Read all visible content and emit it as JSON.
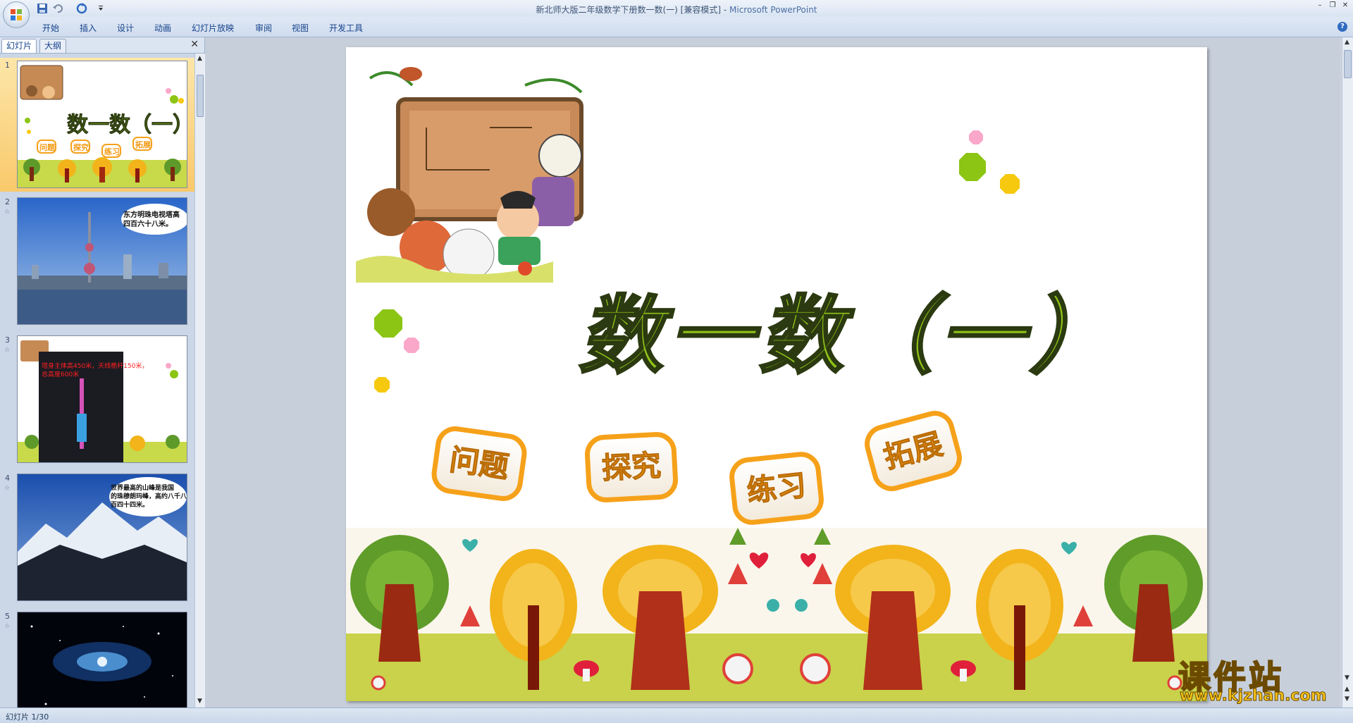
{
  "window": {
    "title_doc": "新北师大版二年级数学下册数一数(一) [兼容模式]",
    "title_sep": " - ",
    "title_app": "Microsoft PowerPoint"
  },
  "ribbon": {
    "tabs": [
      "开始",
      "插入",
      "设计",
      "动画",
      "幻灯片放映",
      "审阅",
      "视图",
      "开发工具"
    ]
  },
  "left_pane": {
    "tabs": [
      "幻灯片",
      "大纲"
    ],
    "thumbnails": [
      {
        "number": "1",
        "selected": true,
        "texts": [
          "数一数（一）",
          "问题",
          "探究",
          "练习",
          "拓展"
        ]
      },
      {
        "number": "2",
        "texts": [
          "东方明珠电视塔高",
          "四百六十八米。"
        ]
      },
      {
        "number": "3",
        "texts": [
          "塔身主体高450米，天线桅杆150米，",
          "总高度600米"
        ]
      },
      {
        "number": "4",
        "texts": [
          "世界最高的山峰是我国",
          "的珠穆朗玛峰，高约八千八",
          "百四十四米。"
        ]
      },
      {
        "number": "5",
        "texts": []
      }
    ]
  },
  "slide": {
    "title": "数一数（一）",
    "buttons": [
      "问题",
      "探究",
      "练习",
      "拓展"
    ],
    "watermark_top": "课件站",
    "watermark_url": "www.kjzhan.com"
  },
  "status": {
    "text": "幻灯片 1/30"
  },
  "colors": {
    "title_green": "#8fc217",
    "pill_orange": "#f6a11a",
    "dot_pink": "#f9a8c9",
    "dot_green": "#8cc514",
    "dot_yellow": "#f6c90f"
  }
}
